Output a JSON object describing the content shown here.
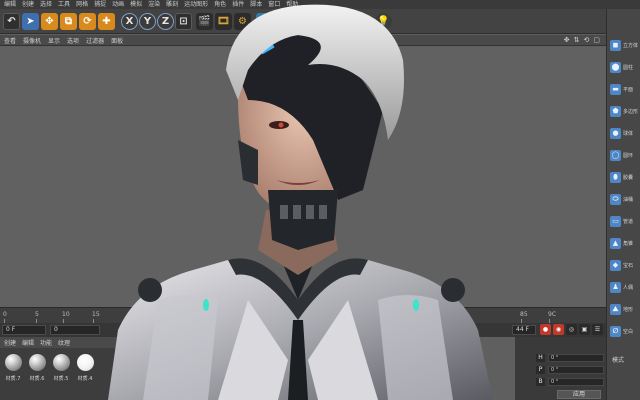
{
  "menubar": {
    "items": [
      "编辑",
      "创建",
      "选择",
      "工具",
      "网格",
      "捕捉",
      "动画",
      "模拟",
      "渲染",
      "雕刻",
      "运动图形",
      "角色",
      "插件",
      "脚本",
      "窗口",
      "帮助"
    ]
  },
  "toolbar": {
    "axis_x": "X",
    "axis_y": "Y",
    "axis_z": "Z"
  },
  "viewmenu": {
    "items": [
      "查看",
      "摄像机",
      "显示",
      "选项",
      "过滤器",
      "面板"
    ]
  },
  "right_panel": {
    "items": [
      {
        "icon": "cube-icon",
        "label": "立方体"
      },
      {
        "icon": "cylinder-icon",
        "label": "圆柱"
      },
      {
        "icon": "plane-icon",
        "label": "平面"
      },
      {
        "icon": "polygon-icon",
        "label": "多边形"
      },
      {
        "icon": "sphere-icon",
        "label": "球体"
      },
      {
        "icon": "torus-icon",
        "label": "圆环"
      },
      {
        "icon": "capsule-icon",
        "label": "胶囊"
      },
      {
        "icon": "oil-tank-icon",
        "label": "油桶"
      },
      {
        "icon": "tube-icon",
        "label": "管道"
      },
      {
        "icon": "pyramid-icon",
        "label": "角锥"
      },
      {
        "icon": "platonic-icon",
        "label": "宝石"
      },
      {
        "icon": "figure-icon",
        "label": "人偶"
      },
      {
        "icon": "landscape-icon",
        "label": "地形"
      },
      {
        "icon": "null-icon",
        "label": "空白"
      }
    ],
    "mode_label": "模式"
  },
  "timeline": {
    "ticks": [
      "0",
      "5",
      "10",
      "15",
      "85",
      "9C"
    ],
    "end_frame": "44 F"
  },
  "frame_controls": {
    "current_frame": "0 F",
    "start_field": "0"
  },
  "materials": {
    "menu": [
      "创建",
      "编辑",
      "功能",
      "纹理"
    ],
    "items": [
      {
        "label": "材质.7",
        "white": false
      },
      {
        "label": "材质.6",
        "white": false
      },
      {
        "label": "材质.5",
        "white": false
      },
      {
        "label": "材质.4",
        "white": true
      }
    ]
  },
  "coordinates": {
    "rows": [
      {
        "axis": "H",
        "value": "0 °"
      },
      {
        "axis": "P",
        "value": "0 °"
      },
      {
        "axis": "B",
        "value": "0 °"
      }
    ],
    "apply_label": "应用"
  }
}
